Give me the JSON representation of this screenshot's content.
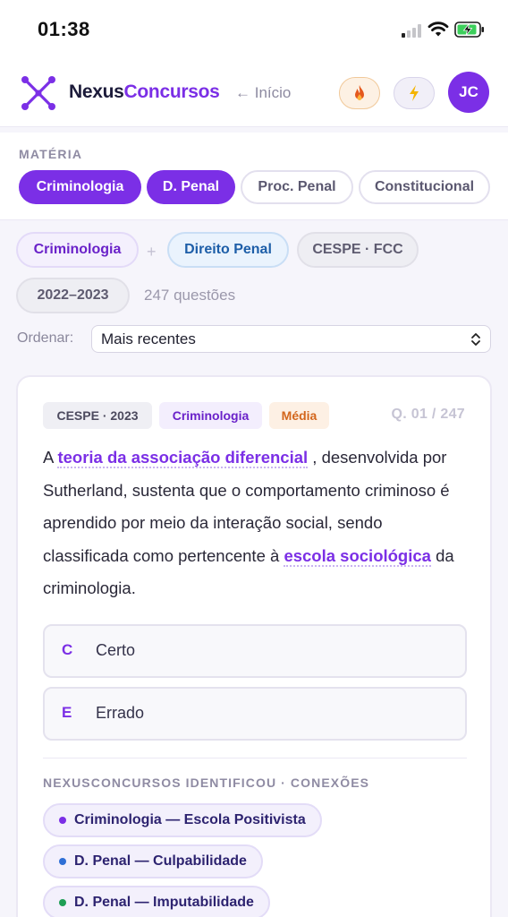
{
  "status": {
    "time": "01:38"
  },
  "header": {
    "brand_a": "Nexus",
    "brand_b": "Concursos",
    "back_label": "← Início",
    "fire_icon": "fire-icon",
    "bolt_icon": "lightning-icon",
    "avatar_initials": "JC"
  },
  "materia": {
    "label": "MATÉRIA",
    "chips": [
      "Criminologia",
      "D. Penal",
      "Proc. Penal",
      "Constitucional"
    ],
    "active": [
      "Criminologia",
      "D. Penal"
    ]
  },
  "filters": {
    "subject1": "Criminologia",
    "plus": "+",
    "subject2": "Direito Penal",
    "boards": "CESPE · FCC",
    "years": "2022–2023",
    "count": "247 questões"
  },
  "sort": {
    "label": "Ordenar:",
    "value": "Mais recentes"
  },
  "question": {
    "source": "CESPE · 2023",
    "subject": "Criminologia",
    "level": "Média",
    "number": "Q. 01 / 247",
    "text_1": "A ",
    "highlight_1": "teoria da associação diferencial",
    "text_2": " , desenvolvida por Sutherland, sustenta que o comportamento criminoso é aprendido por meio da interação social, sendo classificada como pertencente à ",
    "highlight_2": "escola sociológica",
    "text_3": " da criminologia.",
    "options": [
      {
        "letter": "C",
        "label": "Certo"
      },
      {
        "letter": "E",
        "label": "Errado"
      }
    ]
  },
  "connections": {
    "title": "NEXUSCONCURSOS IDENTIFICOU · CONEXÕES",
    "items": [
      {
        "label": "Criminologia — Escola Positivista",
        "color": "#7b2fe6"
      },
      {
        "label": "D. Penal — Culpabilidade",
        "color": "#2f6fd6"
      },
      {
        "label": "D. Penal — Imputabilidade",
        "color": "#1e9e55"
      }
    ]
  },
  "colors": {
    "accent": "#7b2fe6",
    "brand_dark": "#1c1b3a"
  }
}
